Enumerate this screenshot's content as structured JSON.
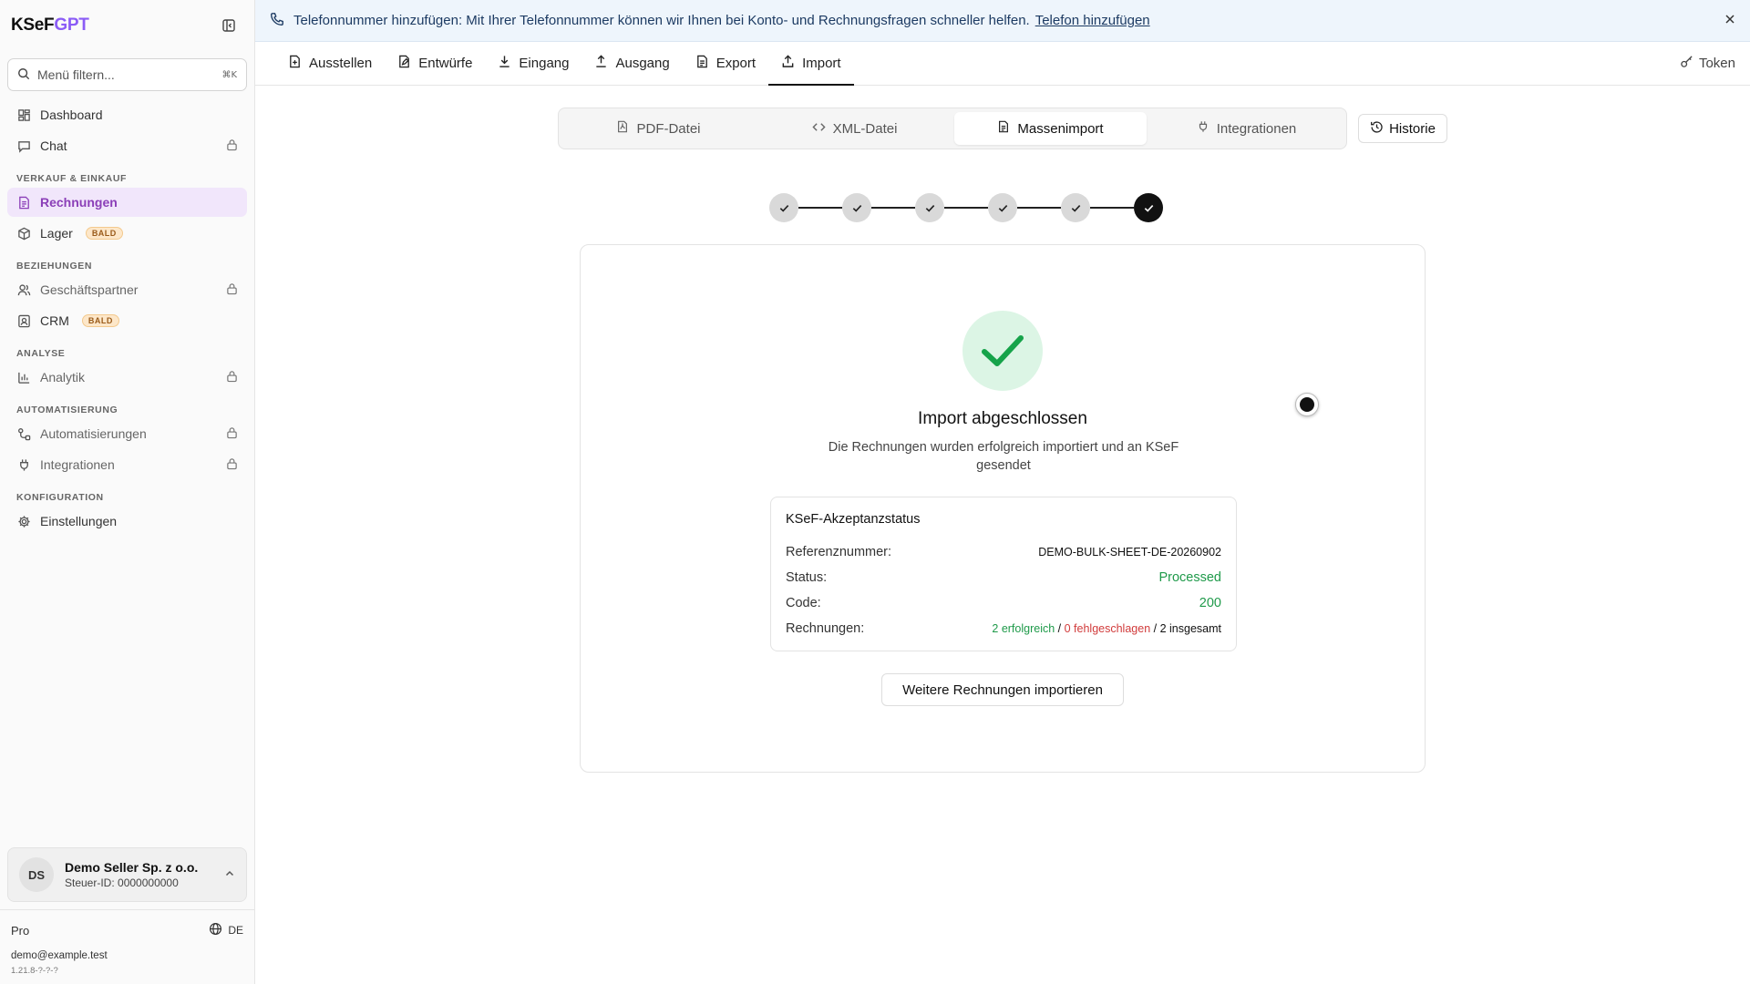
{
  "app": {
    "logo_main": "KSeF",
    "logo_accent": "GPT"
  },
  "sidebar": {
    "search": {
      "placeholder": "Menü filtern...",
      "shortcut": "⌘K"
    },
    "items_top": [
      {
        "label": "Dashboard",
        "icon": "dashboard-icon"
      },
      {
        "label": "Chat",
        "icon": "chat-icon",
        "locked": true
      }
    ],
    "sections": [
      {
        "label": "VERKAUF & EINKAUF",
        "items": [
          {
            "label": "Rechnungen",
            "active": true
          },
          {
            "label": "Lager",
            "badge": "BALD"
          }
        ]
      },
      {
        "label": "BEZIEHUNGEN",
        "items": [
          {
            "label": "Geschäftspartner",
            "locked": true
          },
          {
            "label": "CRM",
            "badge": "BALD"
          }
        ]
      },
      {
        "label": "ANALYSE",
        "items": [
          {
            "label": "Analytik",
            "locked": true
          }
        ]
      },
      {
        "label": "AUTOMATISIERUNG",
        "items": [
          {
            "label": "Automatisierungen",
            "locked": true
          },
          {
            "label": "Integrationen",
            "locked": true
          }
        ]
      },
      {
        "label": "KONFIGURATION",
        "items": [
          {
            "label": "Einstellungen"
          }
        ]
      }
    ],
    "account": {
      "initials": "DS",
      "name": "Demo Seller Sp. z o.o.",
      "tax_id": "Steuer-ID: 0000000000"
    },
    "plan": "Pro",
    "language": "DE",
    "email": "demo@example.test",
    "version": "1.21.8-?-?-?"
  },
  "banner": {
    "text": "Telefonnummer hinzufügen: Mit Ihrer Telefonnummer können wir Ihnen bei Konto- und Rechnungsfragen schneller helfen.",
    "link": "Telefon hinzufügen"
  },
  "topnav": {
    "tabs": [
      "Ausstellen",
      "Entwürfe",
      "Eingang",
      "Ausgang",
      "Export",
      "Import"
    ],
    "active": "Import",
    "token_label": "Token"
  },
  "import_tabs": {
    "items": [
      "PDF-Datei",
      "XML-Datei",
      "Massenimport",
      "Integrationen"
    ],
    "active": "Massenimport",
    "history_label": "Historie"
  },
  "stepper": {
    "total_steps": 6,
    "completed_steps": 6
  },
  "result": {
    "title": "Import abgeschlossen",
    "description": "Die Rechnungen wurden erfolgreich importiert und an KSeF gesendet",
    "status_box": {
      "title": "KSeF-Akzeptanzstatus",
      "ref_label": "Referenznummer:",
      "ref_value": "DEMO-BULK-SHEET-DE-20260902",
      "status_label": "Status:",
      "status_value": "Processed",
      "code_label": "Code:",
      "code_value": "200",
      "invoices_label": "Rechnungen:",
      "invoices_success": "2 erfolgreich",
      "invoices_failed": "0 fehlgeschlagen",
      "invoices_total": "2 insgesamt"
    },
    "button_label": "Weitere Rechnungen importieren"
  },
  "colors": {
    "accent_purple": "#8b3fb8",
    "success_green": "#1f9a4a",
    "fail_red": "#d13b3b",
    "banner_bg": "#eef5fc"
  }
}
